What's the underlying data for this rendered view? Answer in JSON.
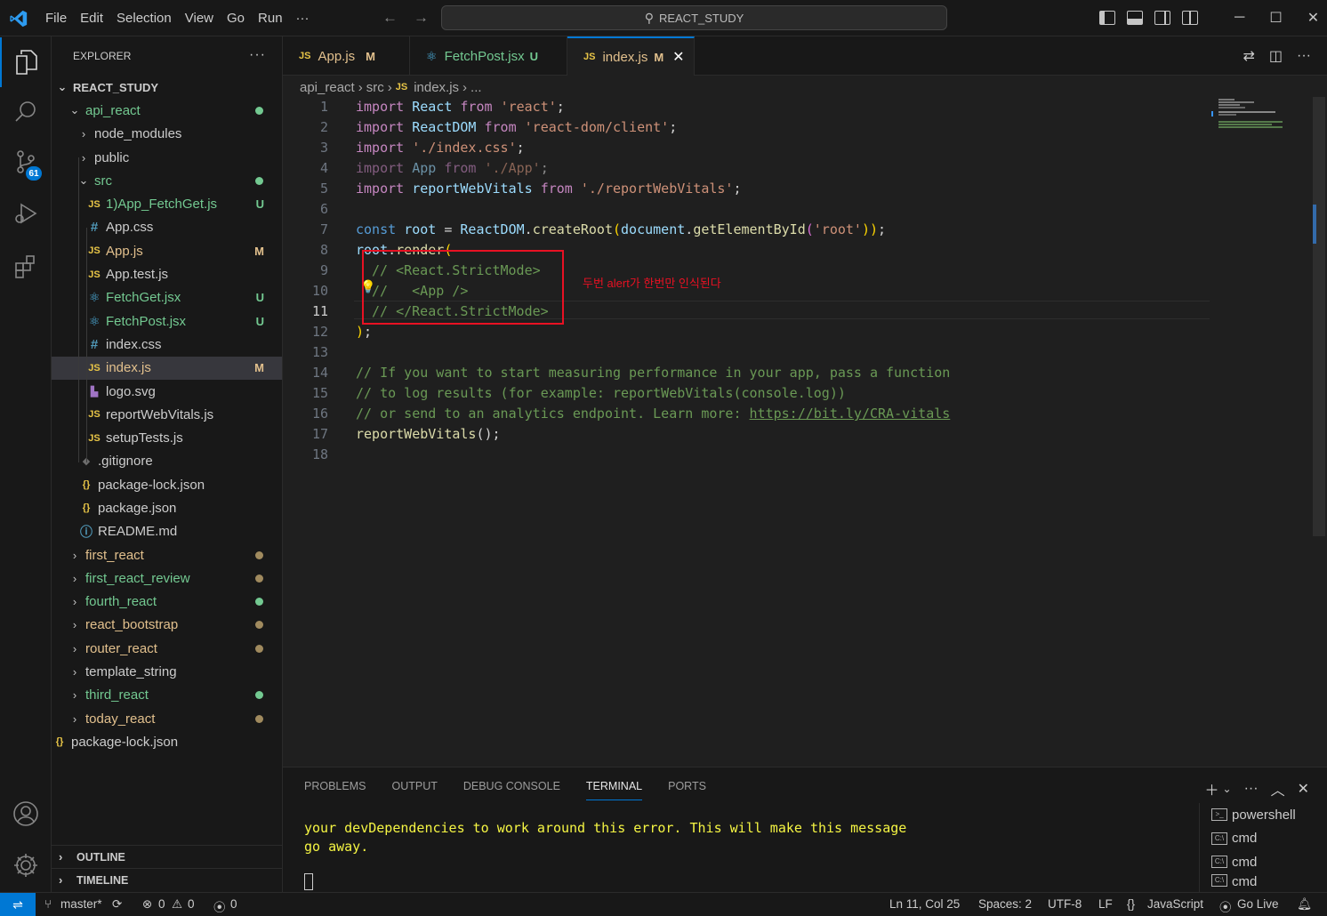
{
  "titlebar": {
    "menu": [
      "File",
      "Edit",
      "Selection",
      "View",
      "Go",
      "Run",
      "···"
    ],
    "search_text": "REACT_STUDY"
  },
  "activity": {
    "scm_badge": "61"
  },
  "explorer": {
    "header": "EXPLORER",
    "root": "REACT_STUDY",
    "items": [
      {
        "label": "api_react",
        "chev": "v",
        "color": "#73c991",
        "dot": "#73c991"
      },
      {
        "label": "node_modules",
        "chev": ">",
        "color": "#cccccc"
      },
      {
        "label": "public",
        "chev": ">",
        "color": "#cccccc"
      },
      {
        "label": "src",
        "chev": "v",
        "color": "#73c991",
        "dot": "#73c991"
      },
      {
        "label": "1)App_FetchGet.js",
        "icon": "JS",
        "color": "#73c991",
        "status": "U"
      },
      {
        "label": "App.css",
        "icon": "#",
        "color": "#cccccc"
      },
      {
        "label": "App.js",
        "icon": "JS",
        "color": "#e2c08d",
        "status": "M"
      },
      {
        "label": "App.test.js",
        "icon": "JS",
        "color": "#cccccc"
      },
      {
        "label": "FetchGet.jsx",
        "icon": "⚛",
        "color": "#73c991",
        "status": "U"
      },
      {
        "label": "FetchPost.jsx",
        "icon": "⚛",
        "color": "#73c991",
        "status": "U"
      },
      {
        "label": "index.css",
        "icon": "#",
        "color": "#cccccc"
      },
      {
        "label": "index.js",
        "icon": "JS",
        "color": "#e2c08d",
        "status": "M"
      },
      {
        "label": "logo.svg",
        "icon": "▙",
        "color": "#cccccc"
      },
      {
        "label": "reportWebVitals.js",
        "icon": "JS",
        "color": "#cccccc"
      },
      {
        "label": "setupTests.js",
        "icon": "JS",
        "color": "#cccccc"
      },
      {
        "label": ".gitignore",
        "icon": "◆",
        "color": "#cccccc"
      },
      {
        "label": "package-lock.json",
        "icon": "{}",
        "color": "#cccccc"
      },
      {
        "label": "package.json",
        "icon": "{}",
        "color": "#cccccc"
      },
      {
        "label": "README.md",
        "icon": "ⓘ",
        "color": "#cccccc"
      },
      {
        "label": "first_react",
        "chev": ">",
        "color": "#e2c08d",
        "dot": "#a08a5e"
      },
      {
        "label": "first_react_review",
        "chev": ">",
        "color": "#73c991",
        "dot": "#a08a5e"
      },
      {
        "label": "fourth_react",
        "chev": ">",
        "color": "#73c991",
        "dot": "#73c991"
      },
      {
        "label": "react_bootstrap",
        "chev": ">",
        "color": "#e2c08d",
        "dot": "#a08a5e"
      },
      {
        "label": "router_react",
        "chev": ">",
        "color": "#e2c08d",
        "dot": "#a08a5e"
      },
      {
        "label": "template_string",
        "chev": ">",
        "color": "#cccccc"
      },
      {
        "label": "third_react",
        "chev": ">",
        "color": "#73c991",
        "dot": "#73c991"
      },
      {
        "label": "today_react",
        "chev": ">",
        "color": "#e2c08d",
        "dot": "#a08a5e"
      },
      {
        "label": "package-lock.json",
        "icon": "{}",
        "color": "#cccccc"
      }
    ],
    "outline": "OUTLINE",
    "timeline": "TIMELINE"
  },
  "tabs": [
    {
      "label": "App.js",
      "icon": "JS",
      "status": "M",
      "color": "#e2c08d"
    },
    {
      "label": "FetchPost.jsx",
      "icon": "⚛",
      "status": "U",
      "color": "#73c991"
    },
    {
      "label": "index.js",
      "icon": "JS",
      "status": "M",
      "color": "#e2c08d",
      "close": "✕"
    }
  ],
  "breadcrumb": {
    "part1": "api_react",
    "part2": "src",
    "file_icon": "JS",
    "file": "index.js",
    "more": "..."
  },
  "editor": {
    "line_numbers": [
      "1",
      "2",
      "3",
      "4",
      "5",
      "6",
      "7",
      "8",
      "9",
      "10",
      "11",
      "12",
      "13",
      "14",
      "15",
      "16",
      "17",
      "18"
    ],
    "line1": {
      "a": "import",
      "b": "React",
      "c": "from",
      "d": "'react'",
      "e": ";"
    },
    "line2": {
      "a": "import",
      "b": "ReactDOM",
      "c": "from",
      "d": "'react-dom/client'",
      "e": ";"
    },
    "line3": {
      "a": "import",
      "d": "'./index.css'",
      "e": ";"
    },
    "line4": {
      "a": "import",
      "b": "App",
      "c": "from",
      "d": "'./App'",
      "e": ";"
    },
    "line5": {
      "a": "import",
      "b": "reportWebVitals",
      "c": "from",
      "d": "'./reportWebVitals'",
      "e": ";"
    },
    "line7": {
      "a": "const",
      "b": "root",
      "c": "=",
      "d": "ReactDOM",
      "e": ".",
      "f": "createRoot",
      "g": "(",
      "h": "document",
      "i": ".",
      "j": "getElementById",
      "k": "(",
      "l": "'root'",
      "m": "))",
      "n": ";"
    },
    "line8": {
      "a": "root",
      "b": ".",
      "c": "render",
      "d": "("
    },
    "line9": "// <React.StrictMode>",
    "line10": "//   <App />",
    "line11": "// </React.StrictMode>",
    "line12": {
      "a": ")",
      "b": ";"
    },
    "line14": "// If you want to start measuring performance in your app, pass a function",
    "line15": "// to log results (for example: reportWebVitals(console.log))",
    "line16": {
      "a": "// or send to an analytics endpoint. Learn more: ",
      "b": "https://bit.ly/CRA-vitals"
    },
    "line17": {
      "a": "reportWebVitals",
      "b": "();"
    },
    "annotation": "두번 alert가 한번만 인식된다"
  },
  "panel": {
    "tabs": [
      "PROBLEMS",
      "OUTPUT",
      "DEBUG CONSOLE",
      "TERMINAL",
      "PORTS"
    ],
    "active_tab": "TERMINAL",
    "terminal_line1": "your devDependencies to work around this error. This will make this message",
    "terminal_line2": "go away.",
    "terminals": [
      "powershell",
      "cmd",
      "cmd",
      "cmd"
    ]
  },
  "statusbar": {
    "branch": "master*",
    "errors": "0",
    "warnings": "0",
    "ports": "0",
    "position": "Ln 11, Col 25",
    "spaces": "Spaces: 2",
    "encoding": "UTF-8",
    "eol": "LF",
    "language": "JavaScript",
    "golive": "Go Live"
  },
  "colors": {
    "accent": "#0078d4",
    "annotation": "#e81123",
    "terminal_text": "#f5f543"
  }
}
